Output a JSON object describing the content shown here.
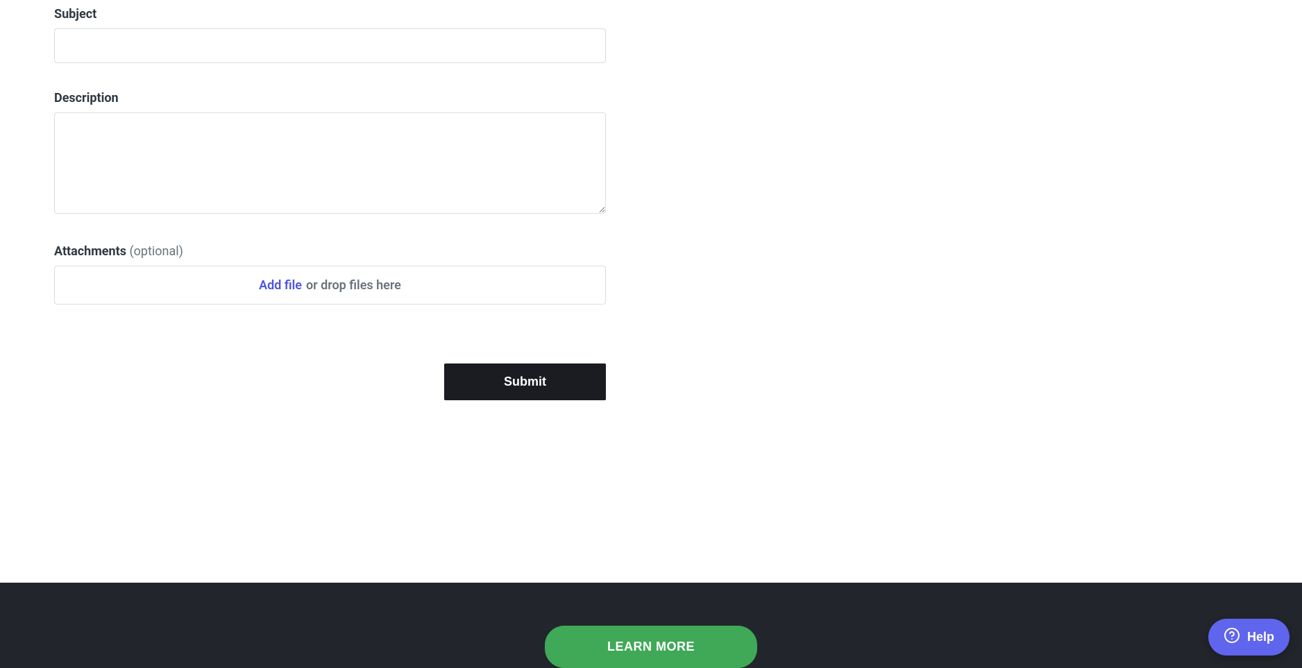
{
  "form": {
    "subject_label": "Subject",
    "subject_value": "",
    "description_label": "Description",
    "description_value": "",
    "attachments_label": "Attachments",
    "attachments_optional": "(optional)",
    "add_file_text": "Add file",
    "drop_text": "or drop files here",
    "submit_label": "Submit"
  },
  "footer": {
    "learn_more_label": "LEARN MORE"
  },
  "help_widget": {
    "label": "Help"
  }
}
